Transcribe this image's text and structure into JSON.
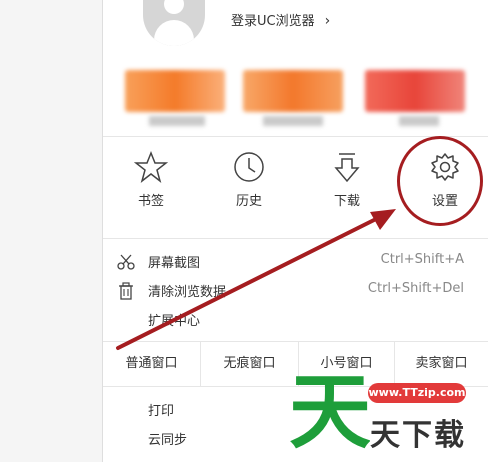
{
  "account": {
    "login_label": "登录UC浏览器",
    "chevron": "›"
  },
  "quick_actions": [
    {
      "label": "书签",
      "icon": "star-icon"
    },
    {
      "label": "历史",
      "icon": "clock-icon"
    },
    {
      "label": "下载",
      "icon": "download-icon"
    },
    {
      "label": "设置",
      "icon": "gear-icon"
    }
  ],
  "menu_items": [
    {
      "label": "屏幕截图",
      "shortcut": "Ctrl+Shift+A",
      "icon": "scissors-icon"
    },
    {
      "label": "清除浏览数据",
      "shortcut": "Ctrl+Shift+Del",
      "icon": "trash-icon"
    },
    {
      "label": "扩展中心",
      "shortcut": ""
    }
  ],
  "window_buttons": [
    "普通窗口",
    "无痕窗口",
    "小号窗口",
    "卖家窗口"
  ],
  "bottom_items": [
    "打印",
    "云同步"
  ],
  "watermark": {
    "url": "www.TTzip.com",
    "text": "天下载",
    "big_char": "天"
  },
  "colors": {
    "annotation_red": "#a51d20",
    "watermark_green": "#1e9e3a",
    "watermark_red": "#e23a3a"
  }
}
